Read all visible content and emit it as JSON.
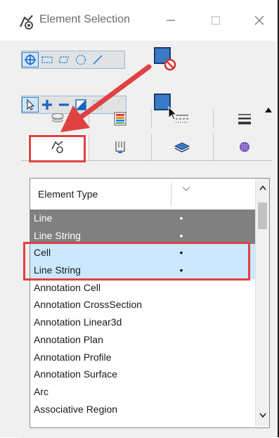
{
  "window": {
    "title": "Element Selection",
    "app_icon": "bentley-element-selection-icon",
    "controls": [
      "minimize",
      "maximize",
      "close"
    ]
  },
  "toolbar1": {
    "tools": [
      "individual-select-icon",
      "block-select-icon",
      "shape-select-icon",
      "circle-select-icon",
      "line-select-icon"
    ],
    "active_index": 0,
    "clear_selection_icon": "clear-selection-icon"
  },
  "toolbar2": {
    "tools": [
      "new-selection-icon",
      "add-to-selection-icon",
      "subtract-from-selection-icon",
      "invert-selection-icon",
      "clear-selection-tool-icon"
    ],
    "active_index": 0,
    "pointer_icon": "select-pointer-icon",
    "expand_icon": "collapse-triangle-icon"
  },
  "tabs_row1": [
    "levels-tab-icon",
    "color-tab-icon",
    "line-style-tab-icon",
    "line-weight-tab-icon"
  ],
  "tabs_row2": [
    "element-type-tab-icon",
    "class-tab-icon",
    "template-tab-icon",
    "material-tab-icon"
  ],
  "selected_tab": "element-type-tab-icon",
  "list": {
    "header": "Element Type",
    "rows": [
      {
        "label": "Line",
        "dot": "•",
        "state": "selected-gray"
      },
      {
        "label": "Line String",
        "dot": "•",
        "state": "selected-gray"
      },
      {
        "label": "Cell",
        "dot": "•",
        "state": "highlighted"
      },
      {
        "label": "Line String",
        "dot": "•",
        "state": "highlighted"
      },
      {
        "label": "Annotation Cell",
        "dot": "",
        "state": "normal"
      },
      {
        "label": "Annotation CrossSection",
        "dot": "",
        "state": "normal"
      },
      {
        "label": "Annotation Linear3d",
        "dot": "",
        "state": "normal"
      },
      {
        "label": "Annotation Plan",
        "dot": "",
        "state": "normal"
      },
      {
        "label": "Annotation Profile",
        "dot": "",
        "state": "normal"
      },
      {
        "label": "Annotation Surface",
        "dot": "",
        "state": "normal"
      },
      {
        "label": "Arc",
        "dot": "",
        "state": "normal"
      },
      {
        "label": "Associative Region",
        "dot": "",
        "state": "normal"
      }
    ]
  },
  "colors": {
    "annotation_red": "#e04141",
    "row_gray": "#808080",
    "row_highlight": "#cce8ff",
    "tool_active": "#cfe5fb"
  }
}
